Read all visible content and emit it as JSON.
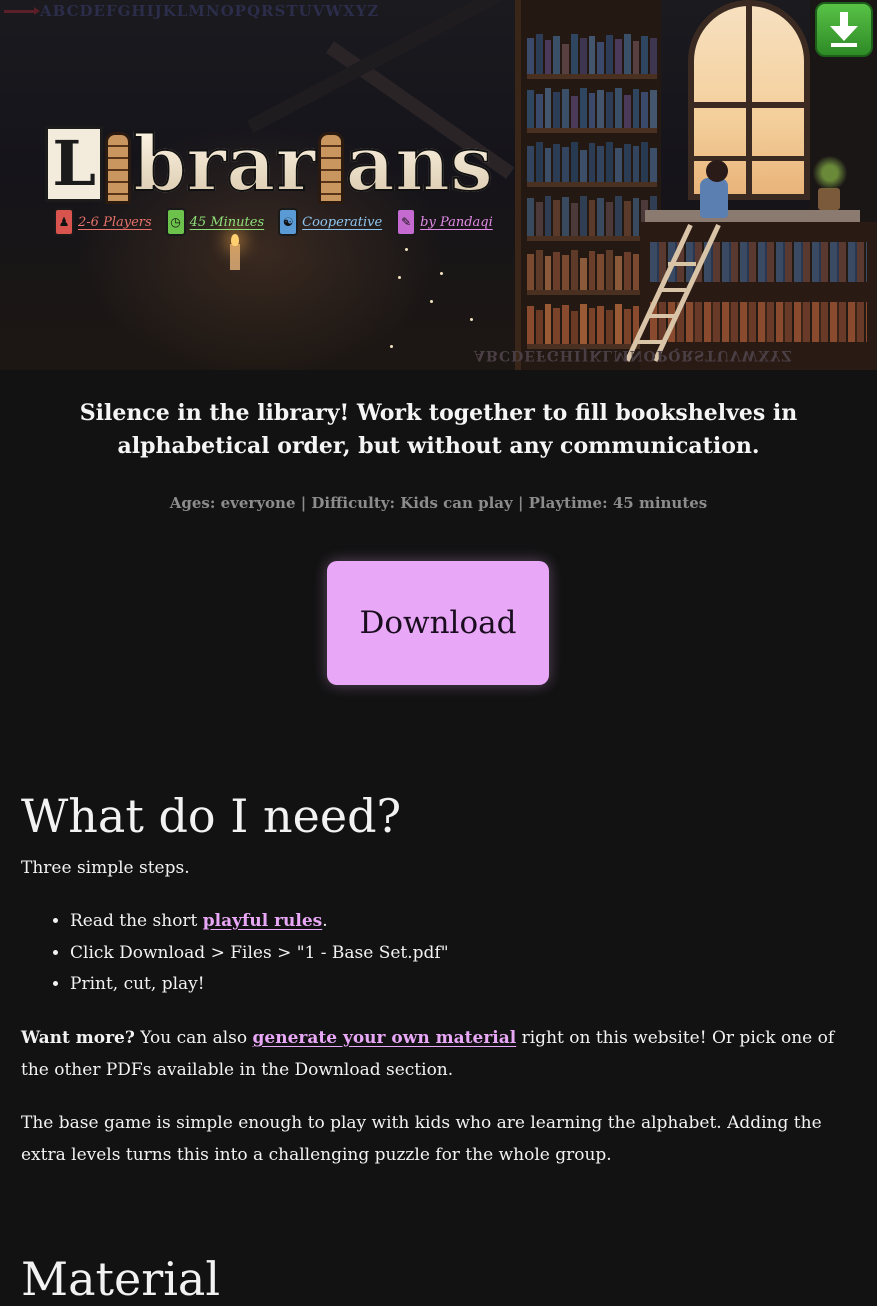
{
  "hero": {
    "logo_text": "Librarians",
    "alphabet_top": "ABCDEFGHIJKLMNOPQRSTUVWXYZ",
    "alphabet_bottom": "ABCDEFGHIJKLMNOPQRSTUVWXYZ",
    "tags": [
      {
        "label": "2-6 Players",
        "color": "#e8736a",
        "icon": "players-icon",
        "icon_bg": "#d9534f"
      },
      {
        "label": "45 Minutes",
        "color": "#8ee07a",
        "icon": "clock-icon",
        "icon_bg": "#6cc24a"
      },
      {
        "label": "Cooperative",
        "color": "#8ec5f0",
        "icon": "handshake-icon",
        "icon_bg": "#5b9bd5"
      },
      {
        "label": "by Pandaqi",
        "color": "#e28be8",
        "icon": "pen-icon",
        "icon_bg": "#c46ad0"
      }
    ]
  },
  "tagline": "Silence in the library! Work together to fill bookshelves in alphabetical order, but without any communication.",
  "meta": "Ages: everyone | Difficulty: Kids can play | Playtime: 45 minutes",
  "download_button": "Download",
  "need": {
    "title": "What do I need?",
    "intro": "Three simple steps.",
    "step1_prefix": "Read the short ",
    "step1_link": "playful rules",
    "step1_suffix": ".",
    "step2": "Click Download > Files > \"1 - Base Set.pdf\"",
    "step3": "Print, cut, play!",
    "more_bold": "Want more?",
    "more_prefix": " You can also ",
    "more_link": "generate your own material",
    "more_suffix": " right on this website! Or pick one of the other PDFs available in the Download section.",
    "base_game": "The base game is simple enough to play with kids who are learning the alphabet. Adding the extra levels turns this into a challenging puzzle for the whole group."
  },
  "material": {
    "title": "Material"
  },
  "colors": {
    "background": "#121212",
    "accent": "#e9a8f7",
    "download_icon_green": "#4cae3c"
  }
}
